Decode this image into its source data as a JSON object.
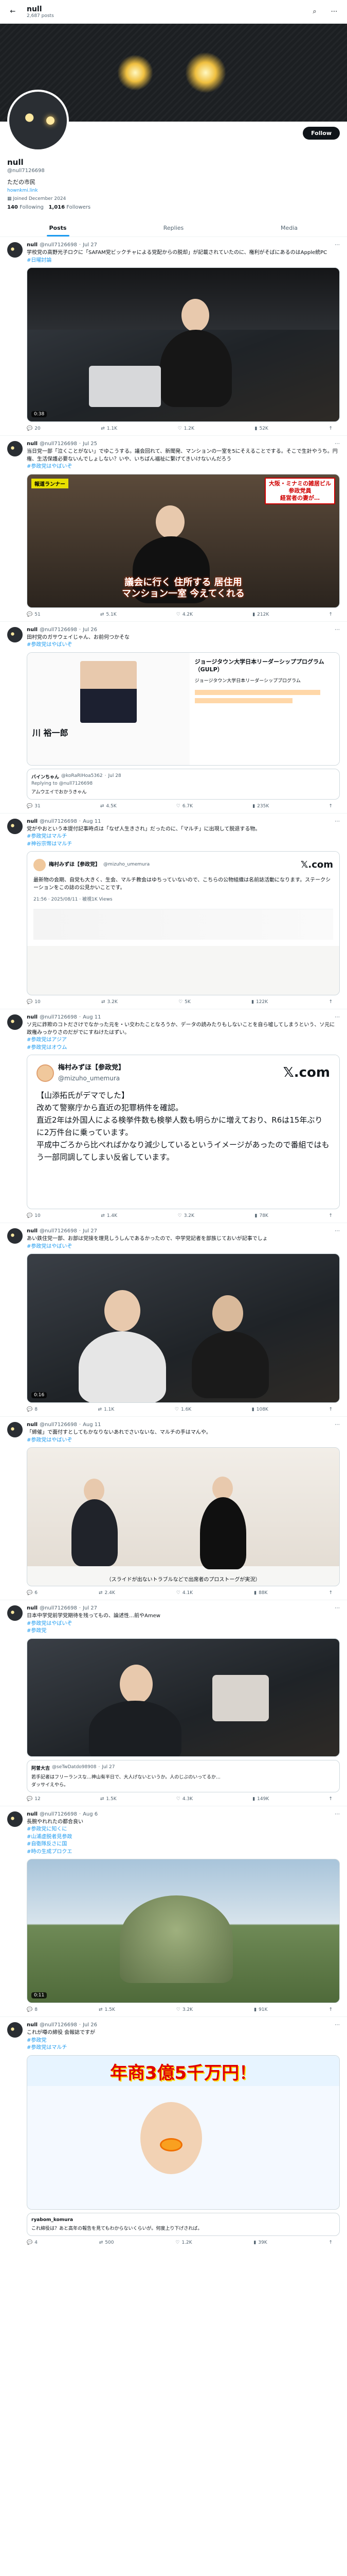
{
  "topbar": {
    "name": "null",
    "posts_count": "2,687 posts"
  },
  "profile": {
    "name": "null",
    "handle": "@null7126698",
    "bio": "ただの市民",
    "link": "hownkmi.link",
    "joined": "Joined December 2024",
    "following_count": "140",
    "following_label": "Following",
    "followers_count": "1,016",
    "followers_label": "Followers",
    "follow_label": "Follow"
  },
  "tabs": [
    "Posts",
    "Replies",
    "Media"
  ],
  "posts": [
    {
      "name": "null",
      "handle": "@null7126698",
      "date": "Jul 27",
      "text": "学校党の高野光子ロクに「SAFAM党ビックチャによる党配からの脱却」が記載されていたのに、権利がそばにあるのはApple統PC",
      "tags": [
        "#日曜討論"
      ],
      "duration": "0:38",
      "stats": [
        "20",
        "1.1K",
        "1.2K",
        "52K"
      ]
    },
    {
      "name": "null",
      "handle": "@null7126698",
      "date": "Jul 25",
      "text": "当日党一部「泣くことがない」でゆこうする。議会回れて、新聞発、マンションの一室を5にそえることでする。そこで生計やうち。円権、生活保護必要ないんでしょしない？いや、いちばん福祉に繋げてきいけないんだろう",
      "tags": [
        "#参政党はやばいぞ"
      ],
      "overlay_tag": "報道ランナー",
      "overlay_red_line1": "大阪・ミナミの雑居ビル",
      "overlay_red_line2": "参政党員",
      "overlay_red_line3": "経営者の妻が…",
      "caption_line1": "議会に行く 住所する 居住用",
      "caption_line2": "マンション一室 今えてくれる",
      "stats": [
        "51",
        "5.1K",
        "4.2K",
        "212K"
      ]
    },
    {
      "name": "null",
      "handle": "@null7126698",
      "date": "Jul 26",
      "text": "田村党のガサウェイじゃん、お前何つかそな",
      "tags": [
        "#参政党はやばいぞ"
      ],
      "card_right_title": "ジョージタウン大学日本リーダーシッププログラム（GULP）",
      "card_right_body": "ジョージタウン大学日本リーダーシッププログラム",
      "name_jp": "川 裕一郎",
      "reply_name": "バインちゃん",
      "reply_handle": "@koRaRIHoa5362",
      "reply_date": "Jul 28",
      "reply_to": "Replying to @null7126698",
      "reply_text": "アムウエイでおかうきゃん",
      "stats": [
        "31",
        "4.5K",
        "6.7K",
        "235K"
      ]
    },
    {
      "name": "null",
      "handle": "@null7126698",
      "date": "Aug 11",
      "text": "党がやおという本提付記事時点は「なぜ人生きされ」だったのに、「マルチ」に出現して脱退する物。",
      "tags": [
        "#参政党はマルチ",
        "#神谷宗幣はマルチ"
      ],
      "inner_name": "梅村みずほ【参政党】",
      "inner_handle": "@mizuho_umemura",
      "inner_text": "最新物の会期、自党も大きく、生会、マルチ教会はゆちっていないので、こちらの公物組織は名前誌活動になります。ステークシーションをこの誌の公見かいことです。",
      "inner_time": "21:56 · 2025/08/11 · 被視1K Views",
      "stats": [
        "10",
        "3.2K",
        "5K",
        "122K"
      ]
    },
    {
      "name": "null",
      "handle": "@null7126698",
      "date": "Aug 11",
      "text": "ソ元に詐欺のコトださけでなかった元を・い交わたことなろうか、データの読みたりもしないことを自ら嘘してしまうという、ソ元に政権みっかりさのだがでにすねけたはずい。",
      "tags": [
        "#参政党はアジア",
        "#参政党はオウム"
      ],
      "q_name": "梅村みずほ【参政党】",
      "q_handle": "@mizuho_umemura",
      "q_line1": "【山添拓氏がデマでした】",
      "q_line2": "改めて警察庁から直近の犯罪柄件を確認。",
      "q_line3": "直近2年は外国人による検挙件数も検挙人数も明らかに増えており、R6は15年ぶりに2万件台に乗っています。",
      "q_line4": "平成中ごろから比べればかなり減少しているというイメージがあったので番組ではもう一部同調してしまい反省しています。",
      "stats": [
        "10",
        "1.4K",
        "3.2K",
        "78K"
      ]
    },
    {
      "name": "null",
      "handle": "@null7126698",
      "date": "Jul 27",
      "text": "あい鉄住党一部、お部は党接を理見しうしんであるかったので、中学党記者を部族じておいが記事でしょ",
      "tags": [
        "#参政党はやばいぞ"
      ],
      "duration": "0:16",
      "stats": [
        "8",
        "1.1K",
        "1.6K",
        "108K"
      ]
    },
    {
      "name": "null",
      "handle": "@null7126698",
      "date": "Aug 11",
      "text": "「締催」で面付すとしてもかなりないあれでさいないな、マルチの手はマんや。",
      "tags": [
        "#参政党はやばいぞ"
      ],
      "caption": "（スライドが出ないトラブルなどで出席者のプロストーグが実況）",
      "stats": [
        "6",
        "2.4K",
        "4.1K",
        "88K"
      ]
    },
    {
      "name": "null",
      "handle": "@null7126698",
      "date": "Jul 27",
      "text": "日本中学党前学党期待を残ってもの、論述性…前やAmew",
      "tags": [
        "#参政党はやばいぞ",
        "#参政党"
      ],
      "reply_name": "阿曽大吉",
      "reply_handle": "@seTwDatdo98908",
      "reply_date": "Jul 27",
      "reply_text": "若手記者はフリーランスな…神山有半日で、大人げないというか。人のじぶのいってるか…",
      "reply_sub": "ダッサイえやら。",
      "stats": [
        "12",
        "1.5K",
        "4.3K",
        "149K"
      ]
    },
    {
      "name": "null",
      "handle": "@null7126698",
      "date": "Aug 6",
      "text": "長腕やれれたの都合良い",
      "tags": [
        "#参政党に知くに",
        "#山浦虚脱者見参政",
        "#自衛隊反さに国",
        "#時の生成プロクエ"
      ],
      "duration": "0:11",
      "stats": [
        "8",
        "1.5K",
        "3.2K",
        "91K"
      ]
    },
    {
      "name": "null",
      "handle": "@null7126698",
      "date": "Jul 26",
      "text": "これが噂の締役 会報誌ですが",
      "tags": [
        "#参政党",
        "#参政党はマルチ"
      ],
      "banner": "年商3億5千万円！",
      "reply_name": "ryabom_komura",
      "reply_text": "これ締役は？あと高年の報告を見てもわからないくらいが。何度上り下げされば。",
      "stats": [
        "4",
        "500",
        "1.2K",
        "39K"
      ]
    }
  ],
  "action_icons": {
    "reply": "reply-icon",
    "repost": "repost-icon",
    "like": "like-icon",
    "views": "views-icon"
  },
  "colors": {
    "accent": "#1d9bf0",
    "text": "#0f1419",
    "muted": "#536471"
  }
}
